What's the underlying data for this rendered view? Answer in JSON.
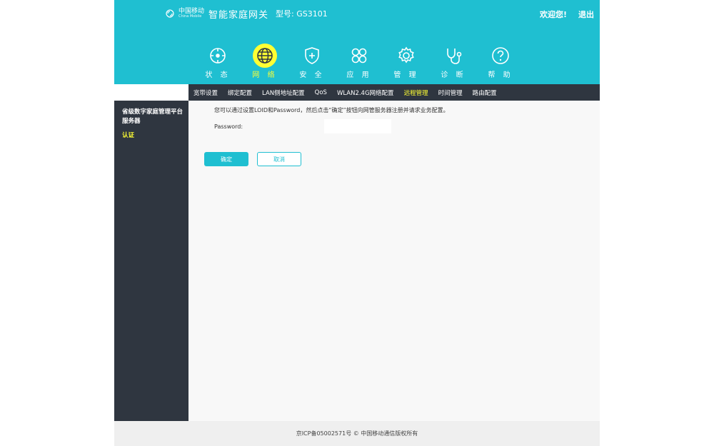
{
  "header": {
    "brand_cn": "中国移动",
    "brand_en": "China Mobile",
    "title": "智能家庭网关",
    "model": "型号: GS3101",
    "welcome": "欢迎您!",
    "logout": "退出",
    "bg_color": "#1fbfd1"
  },
  "nav": {
    "items": [
      {
        "label": "状 态",
        "icon": "status-icon"
      },
      {
        "label": "网 络",
        "icon": "globe-icon",
        "active": true
      },
      {
        "label": "安 全",
        "icon": "shield-icon"
      },
      {
        "label": "应 用",
        "icon": "apps-icon"
      },
      {
        "label": "管 理",
        "icon": "gear-icon"
      },
      {
        "label": "诊 断",
        "icon": "stethoscope-icon"
      },
      {
        "label": "帮 助",
        "icon": "help-icon"
      }
    ],
    "active_color": "#ffff33"
  },
  "subnav": {
    "items": [
      "宽带设置",
      "绑定配置",
      "LAN侧地址配置",
      "QoS",
      "WLAN2.4G网络配置",
      "远程管理",
      "时间管理",
      "路由配置"
    ],
    "active": "远程管理"
  },
  "sidebar": {
    "title": "省级数字家庭管理平台服务器",
    "item": "认证"
  },
  "content": {
    "description": "您可以通过设置LOID和Password，然后点击“确定”按钮向网管服务器注册并请求业务配置。",
    "password_label": "Password:",
    "password_value": "",
    "ok_button": "确定",
    "cancel_button": "取消"
  },
  "footer": {
    "text": "京ICP备05002571号 © 中国移动通信版权所有"
  }
}
